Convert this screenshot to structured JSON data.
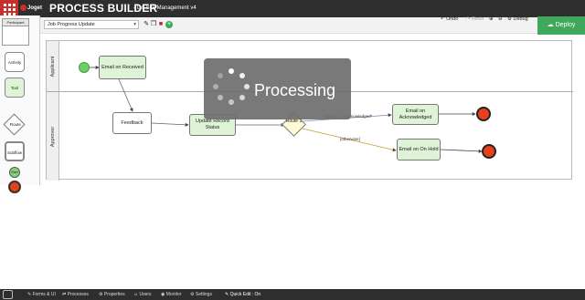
{
  "header": {
    "logo_text": "Joget",
    "app_title": "PROCESS BUILDER",
    "app_subtitle": "- On-Site Management v4"
  },
  "toolbar": {
    "process_select_value": "Job Progress Update",
    "undo_label": "Undo",
    "redo_label": "Redo",
    "debug_label": "Debug",
    "deploy_label": "Deploy"
  },
  "palette": {
    "participant_label": "Participant",
    "activity_label": "Activity",
    "tool_label": "Tool",
    "route_label": "Route",
    "subflow_label": "Subflow",
    "start_label": "Start"
  },
  "lanes": [
    {
      "label": "Applicant"
    },
    {
      "label": "Approver"
    }
  ],
  "nodes": {
    "email_on_received": "Email on Received",
    "feedback": "Feedback",
    "update_record_status": "Update Record Status",
    "route1": "Route 1",
    "email_on_acknowledged": "Email on Acknowledged",
    "email_on_hold": "Email on On Hold"
  },
  "flow_labels": {
    "acknowledged_condition": "status == \"Acknowledged\"",
    "otherwise": "[otherwise]"
  },
  "overlay": {
    "processing_label": "Processing"
  },
  "bottom_nav": {
    "forms_ui": "Forms & UI",
    "processes": "Processes",
    "properties": "Properties",
    "users": "Users",
    "monitor": "Monitor",
    "settings": "Settings",
    "quick_edit": "Quick Edit : On"
  },
  "colors": {
    "deploy_green": "#3fa85c",
    "node_green": "#dff3d6",
    "end_red": "#e8401c",
    "topbar_dark": "#2e2e2e"
  }
}
